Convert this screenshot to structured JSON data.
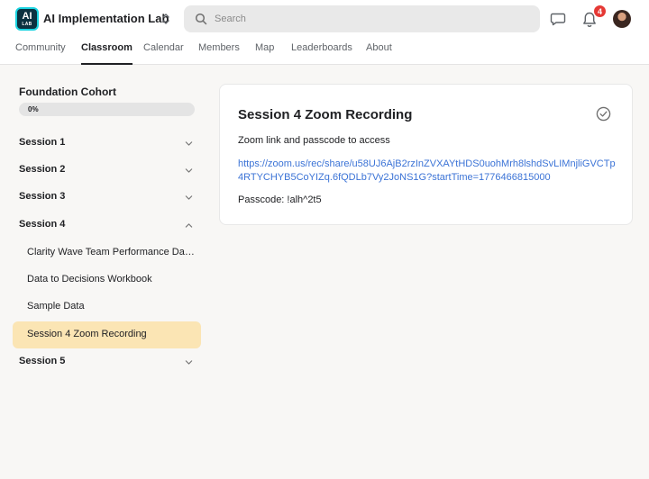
{
  "header": {
    "logo_line1": "AI",
    "logo_line2": "LAB",
    "app_title": "AI Implementation Lab",
    "search_placeholder": "Search",
    "notifications_count": "4",
    "colors": {
      "accent": "#1ad3e0",
      "badge": "#e53935"
    }
  },
  "nav": {
    "tabs": [
      {
        "label": "Community",
        "active": false
      },
      {
        "label": "Classroom",
        "active": true
      },
      {
        "label": "Calendar",
        "active": false
      },
      {
        "label": "Members",
        "active": false
      },
      {
        "label": "Map",
        "active": false
      },
      {
        "label": "Leaderboards",
        "active": false
      },
      {
        "label": "About",
        "active": false
      }
    ]
  },
  "sidebar": {
    "cohort_title": "Foundation Cohort",
    "progress_label": "0%",
    "progress_value": 0,
    "sessions": [
      {
        "label": "Session 1",
        "expanded": false
      },
      {
        "label": "Session 2",
        "expanded": false
      },
      {
        "label": "Session 3",
        "expanded": false
      },
      {
        "label": "Session 4",
        "expanded": true
      },
      {
        "label": "Session 5",
        "expanded": false
      }
    ],
    "lessons": [
      {
        "label": "Clarity Wave Team Performance Dashboard",
        "active": false
      },
      {
        "label": "Data to Decisions Workbook",
        "active": false
      },
      {
        "label": "Sample Data",
        "active": false
      },
      {
        "label": "Session 4 Zoom Recording",
        "active": true
      }
    ],
    "colors": {
      "active_lesson": "#fbe5b4",
      "progress_fill": "#f4c542"
    }
  },
  "content": {
    "title": "Session 4 Zoom Recording",
    "description": "Zoom link and passcode to access",
    "link": "https://zoom.us/rec/share/u58UJ6AjB2rzInZVXAYtHDS0uohMrh8lshdSvLIMnjliGVCTp4RTYCHYB5CoYIZq.6fQDLb7Vy2JoNS1G?startTime=1776466815000",
    "passcode": "Passcode: !alh^2t5",
    "colors": {
      "link": "#3b73d6"
    }
  },
  "icons": {
    "search": "search-icon",
    "switcher": "chevron-up-down-icon",
    "chat": "chat-bubble-icon",
    "notifications": "bell-icon",
    "complete": "check-circle-icon",
    "chevron_down": "chevron-down-icon",
    "chevron_up": "chevron-up-icon"
  }
}
